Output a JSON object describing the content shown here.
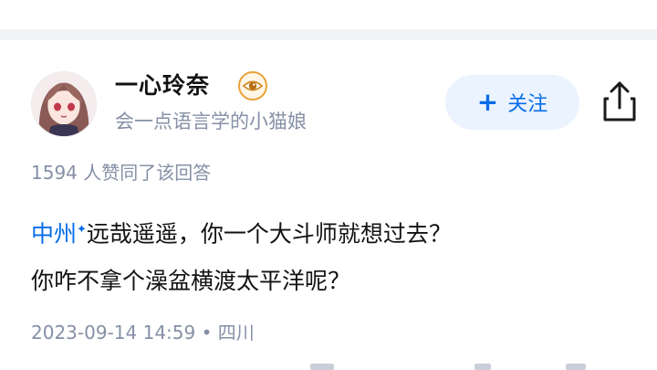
{
  "answer": {
    "author": {
      "name": "一心玲奈",
      "bio": "会一点语言学的小猫娘"
    },
    "follow_button": {
      "icon": "plus-icon",
      "label": "关注"
    },
    "share_icon": "share-icon",
    "vote_text": "1594 人赞同了该回答",
    "content": {
      "mention": "中州",
      "mention_mark": "✦",
      "line1": "远哉遥遥，你一个大斗师就想过去？",
      "line2": "你咋不拿个澡盆横渡太平洋呢？"
    },
    "meta": {
      "timestamp": "2023-09-14 14:59",
      "separator": "•",
      "location": "四川"
    }
  },
  "colors": {
    "accent": "#056de8",
    "follow_bg": "#ebf3ff",
    "muted_text": "#8590a6",
    "main_text": "#121212",
    "divider": "#f2f3f7"
  }
}
